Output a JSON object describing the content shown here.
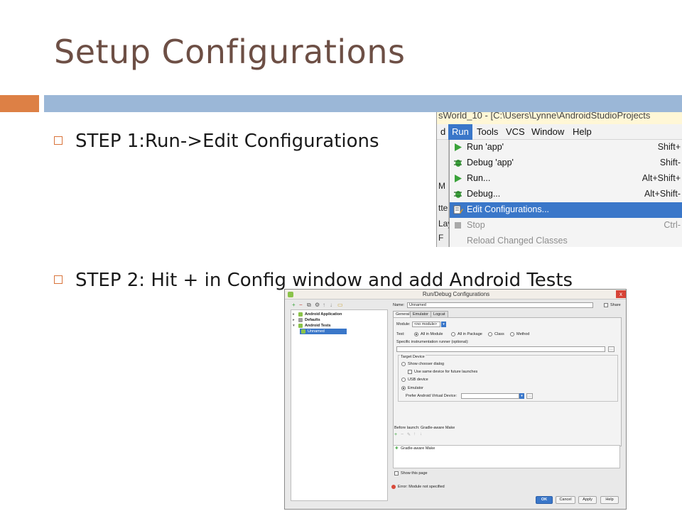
{
  "slide": {
    "title": "Setup Configurations",
    "bullets": [
      {
        "text": "STEP 1:Run->Edit Configurations"
      },
      {
        "text": "STEP 2: Hit + in Config window and add Android Tests"
      }
    ],
    "accent_color": "#dd8045",
    "bar_color": "#9bb7d7",
    "title_color": "#6d4f45"
  },
  "screenshot1": {
    "title_fragment": "sWorld_10 - [C:\\Users\\Lynne\\AndroidStudioProjects",
    "menubar": [
      "d",
      "Run",
      "Tools",
      "VCS",
      "Window",
      "Help"
    ],
    "left_strip": [
      "M",
      "tte",
      "Lay",
      "F"
    ],
    "run_menu": [
      {
        "label": "Run 'app'",
        "shortcut": "Shift+",
        "icon": "run-icon"
      },
      {
        "label": "Debug 'app'",
        "shortcut": "Shift-",
        "icon": "debug-icon"
      },
      {
        "label": "Run...",
        "shortcut": "Alt+Shift+",
        "icon": "run-icon"
      },
      {
        "label": "Debug...",
        "shortcut": "Alt+Shift-",
        "icon": "debug-icon"
      },
      {
        "label": "Edit Configurations...",
        "shortcut": "",
        "icon": "edit-config-icon"
      },
      {
        "label": "Stop",
        "shortcut": "Ctrl-",
        "icon": "stop-icon"
      },
      {
        "label": "Reload Changed Classes",
        "shortcut": "",
        "icon": ""
      }
    ]
  },
  "screenshot2": {
    "window_title": "Run/Debug Configurations",
    "close_label": "x",
    "toolbar": [
      "+",
      "−",
      "⧉",
      "⚙",
      "↑",
      "↓",
      "▭"
    ],
    "tree": [
      {
        "arrow": "▸",
        "label": "Android Application"
      },
      {
        "arrow": "▸",
        "label": "Defaults"
      },
      {
        "arrow": "▾",
        "label": "Android Tests"
      },
      {
        "arrow": "",
        "label": "Unnamed"
      }
    ],
    "name_label": "Name:",
    "name_value": "Unnamed",
    "share_label": "Share",
    "tabs": [
      "General",
      "Emulator",
      "Logcat"
    ],
    "module_label": "Module:",
    "module_value": "<no module>",
    "test_label": "Test:",
    "test_options": [
      "All in Module",
      "All in Package",
      "Class",
      "Method"
    ],
    "runner_label": "Specific instrumentation runner (optional):",
    "target_device_label": "Target Device",
    "show_chooser_label": "Show chooser dialog",
    "use_same_label": "Use same device for future launches",
    "usb_label": "USB device",
    "emulator_label": "Emulator",
    "prefer_avd_label": "Prefer Android Virtual Device:",
    "before_launch_label": "Before launch: Gradle-aware Make",
    "before_launch_item": "Gradle-aware Make",
    "show_page_label": "Show this page",
    "error_text": "Error: Module not specified",
    "buttons": [
      "OK",
      "Cancel",
      "Apply",
      "Help"
    ]
  }
}
